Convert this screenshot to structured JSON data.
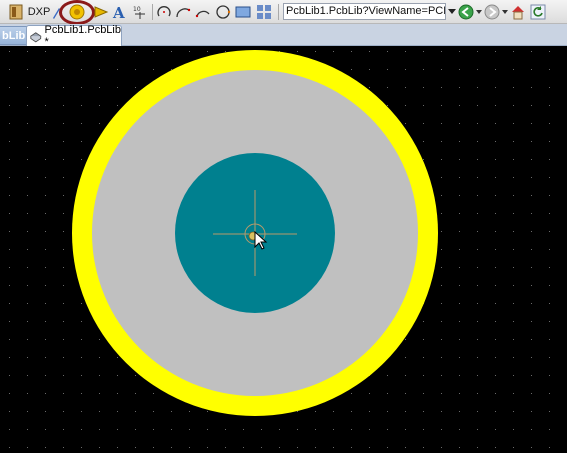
{
  "toolbar": {
    "app_label": "DXP",
    "address": "PcbLib1.PcbLib?ViewName=PCBEditor",
    "icons": [
      "app-icon",
      "pencil-icon",
      "place-pad-icon",
      "place-via-icon",
      "place-string-icon",
      "place-coordinate-icon",
      "arc-center-icon",
      "arc-edge-icon",
      "arc-any-icon",
      "full-circle-icon",
      "fill-icon",
      "array-paste-icon",
      "dropdown-arrow-icon",
      "back-icon",
      "forward-icon",
      "home-icon",
      "refresh-icon"
    ]
  },
  "tabs": {
    "previous_tab": "bLib",
    "active_tab": "PcbLib1.PcbLib *"
  },
  "canvas": {
    "background": "#000000",
    "pad": {
      "outer_ring_color": "#ffff00",
      "mask_color": "#c0c0c0",
      "copper_color": "#00808f",
      "origin_marker": "crosshair-icon",
      "cursor": "mouse-pointer-icon"
    }
  }
}
